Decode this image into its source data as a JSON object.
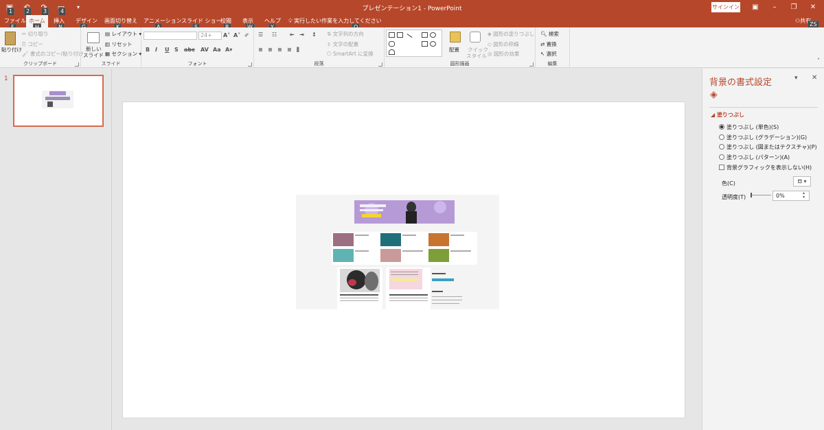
{
  "window": {
    "title": "プレゼンテーション1 - PowerPoint",
    "signin": "サインイン",
    "share": "共有"
  },
  "qat": [
    {
      "icon": "save-icon",
      "keytip": "1"
    },
    {
      "icon": "undo-icon",
      "keytip": "2"
    },
    {
      "icon": "redo-icon",
      "keytip": "3"
    },
    {
      "icon": "slideshow-start-icon",
      "keytip": "4"
    }
  ],
  "tabs": [
    {
      "label": "ファイル",
      "keytip": "F"
    },
    {
      "label": "ホーム",
      "keytip": "H"
    },
    {
      "label": "挿入",
      "keytip": "N"
    },
    {
      "label": "デザイン",
      "keytip": "G"
    },
    {
      "label": "画面切り替え",
      "keytip": "K"
    },
    {
      "label": "アニメーション",
      "keytip": "A"
    },
    {
      "label": "スライド ショー",
      "keytip": "S"
    },
    {
      "label": "校閲",
      "keytip": "R"
    },
    {
      "label": "表示",
      "keytip": "W"
    },
    {
      "label": "ヘルプ",
      "keytip": "Y"
    }
  ],
  "tellme": {
    "text": "実行したい作業を入力してください",
    "keytip": "Q"
  },
  "user_keytip": "ZS",
  "ribbon": {
    "clipboard": {
      "label": "クリップボード",
      "paste": "貼り付け",
      "cut": "切り取り",
      "copy": "コピー",
      "format_painter": "書式のコピー/貼り付け"
    },
    "slides": {
      "label": "スライド",
      "new_slide_1": "新しい",
      "new_slide_2": "スライド",
      "layout": "レイアウト",
      "reset": "リセット",
      "section": "セクション"
    },
    "font": {
      "label": "フォント",
      "size": "24+"
    },
    "paragraph": {
      "label": "段落",
      "text_direction": "文字列の方向",
      "align_text": "文字の配置",
      "smartart": "SmartArt に変換"
    },
    "drawing": {
      "label": "図形描画",
      "arrange": "配置",
      "quick_styles_1": "クイック",
      "quick_styles_2": "スタイル",
      "shape_fill": "図形の塗りつぶし",
      "shape_outline": "図形の枠線",
      "shape_effects": "図形の効果"
    },
    "editing": {
      "label": "編集",
      "find": "検索",
      "replace": "置換",
      "select": "選択"
    }
  },
  "thumbnails": [
    {
      "number": "1"
    }
  ],
  "format_pane": {
    "title": "背景の書式設定",
    "section": "塗りつぶし",
    "options": [
      {
        "label": "塗りつぶし (単色)(S)",
        "selected": true
      },
      {
        "label": "塗りつぶし (グラデーション)(G)",
        "selected": false
      },
      {
        "label": "塗りつぶし (図またはテクスチャ)(P)",
        "selected": false
      },
      {
        "label": "塗りつぶし (パターン)(A)",
        "selected": false
      }
    ],
    "hide_graphics": "背景グラフィックを表示しない(H)",
    "color_label": "色(C)",
    "transparency_label": "透明度(T)",
    "transparency_value": "0%"
  },
  "colors": {
    "accent": "#b7472a",
    "ribbon": "#f3f3f3",
    "workspace": "#e6e6e6"
  }
}
